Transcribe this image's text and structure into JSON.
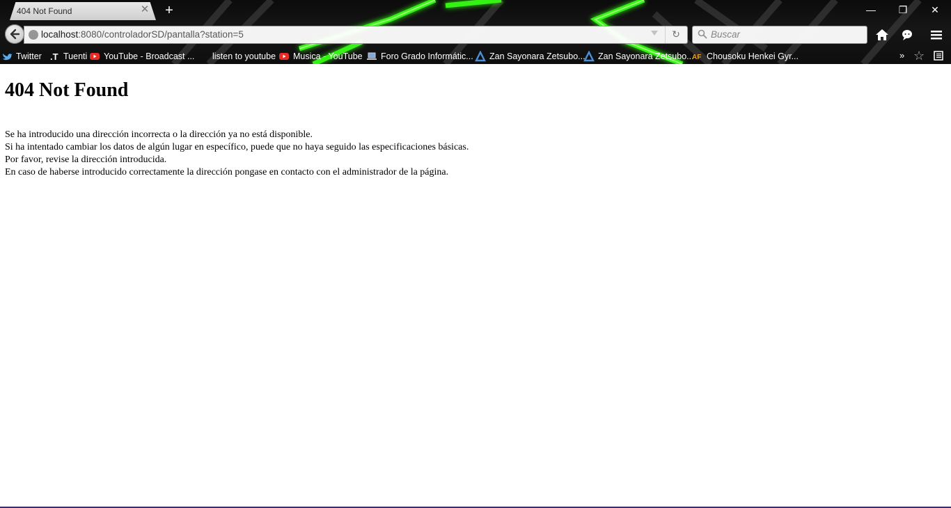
{
  "window": {
    "tab_title": "404 Not Found",
    "tab_close": "✕",
    "new_tab": "+",
    "minimize": "—",
    "restore": "❐",
    "close": "✕"
  },
  "toolbar": {
    "url_host": "localhost",
    "url_rest": ":8080/controladorSD/pantalla?station=5",
    "search_placeholder": "Buscar",
    "reload_glyph": "↻"
  },
  "bookmarks": [
    {
      "label": "Twitter",
      "icon": "twitter-icon",
      "color": "#55acee"
    },
    {
      "label": "Tuenti",
      "icon": "tuenti-icon",
      "color": "#ffffff"
    },
    {
      "label": "YouTube - Broadcast ...",
      "icon": "youtube-icon",
      "color": "#e52d27"
    },
    {
      "label": "listen to youtube",
      "icon": "",
      "color": ""
    },
    {
      "label": "Musica - YouTube",
      "icon": "youtube-icon",
      "color": "#e52d27"
    },
    {
      "label": "Foro Grado Informátic...",
      "icon": "laptop-icon",
      "color": "#7fa8e0"
    },
    {
      "label": "Zan Sayonara Zetsubo...",
      "icon": "anime-a-icon",
      "color": "#4a90d9"
    },
    {
      "label": "Zan Sayonara Zetsubo...",
      "icon": "anime-a-icon",
      "color": "#4a90d9"
    },
    {
      "label": "Chousoku Henkei Gyr...",
      "icon": "af-icon",
      "color": "#e0a030"
    }
  ],
  "bookmarks_more": "»",
  "bookmark_star": "☆",
  "page": {
    "heading": "404 Not Found",
    "lines": [
      "Se ha introducido una dirección incorrecta o la dirección ya no está disponible.",
      "Si ha intentado cambiar los datos de algún lugar en específico, puede que no haya seguido las especificaciones básicas.",
      "Por favor, revise la dirección introducida.",
      "En caso de haberse introducido correctamente la dirección pongase en contacto con el administrador de la página."
    ]
  },
  "colors": {
    "theme_green": "#39ff14",
    "chrome_dark": "#111111"
  }
}
